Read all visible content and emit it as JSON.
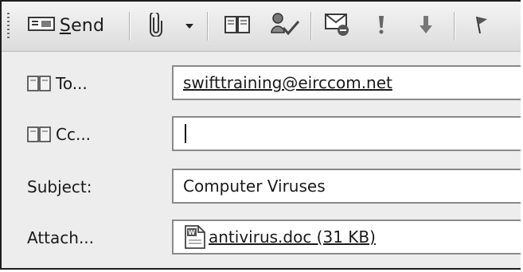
{
  "toolbar": {
    "send_label_prefix": "",
    "send_label_underline": "S",
    "send_label_rest": "end"
  },
  "form": {
    "to": {
      "label": "To...",
      "value": "swifttraining@eirccom.net"
    },
    "cc": {
      "label": "Cc...",
      "value": ""
    },
    "subject": {
      "label": "Subject:",
      "value": "Computer Viruses"
    },
    "attach": {
      "label": "Attach...",
      "value": "antivirus.doc (31 KB)"
    }
  },
  "icons": {
    "send": "send-envelope-icon",
    "attach": "paperclip-icon",
    "address_book": "address-book-icon",
    "check_names": "check-names-icon",
    "options": "message-options-icon",
    "importance_high": "importance-high-icon",
    "importance_low": "importance-low-icon",
    "flag": "follow-up-flag-icon",
    "word_doc": "word-document-icon"
  }
}
